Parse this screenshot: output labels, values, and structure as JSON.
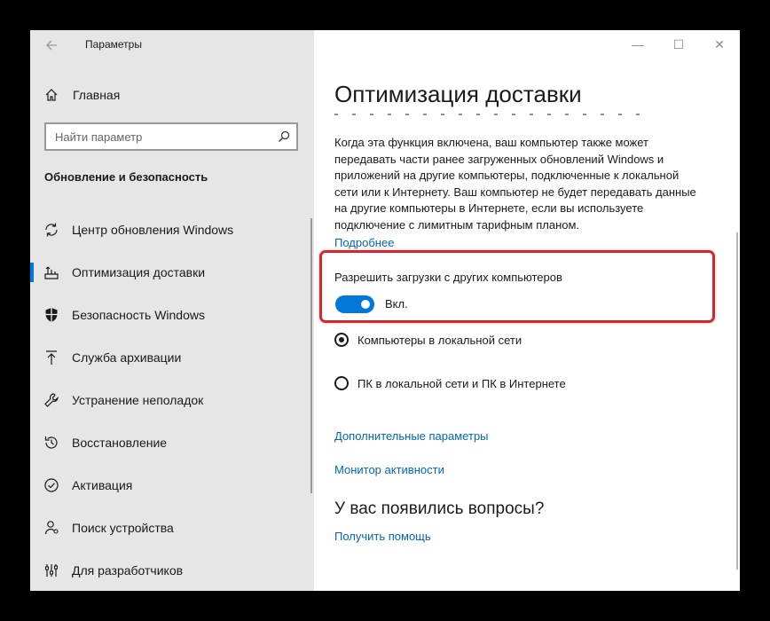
{
  "window": {
    "title": "Параметры",
    "controls": {
      "minimize": "—",
      "maximize": "☐",
      "close": "✕"
    }
  },
  "sidebar": {
    "home_label": "Главная",
    "search_placeholder": "Найти параметр",
    "section_title": "Обновление и безопасность",
    "items": [
      {
        "label": "Центр обновления Windows",
        "icon": "sync-icon",
        "active": false
      },
      {
        "label": "Оптимизация доставки",
        "icon": "delivery-optimization-icon",
        "active": true
      },
      {
        "label": "Безопасность Windows",
        "icon": "shield-icon",
        "active": false
      },
      {
        "label": "Служба архивации",
        "icon": "backup-icon",
        "active": false
      },
      {
        "label": "Устранение неполадок",
        "icon": "wrench-icon",
        "active": false
      },
      {
        "label": "Восстановление",
        "icon": "history-icon",
        "active": false
      },
      {
        "label": "Активация",
        "icon": "check-circle-icon",
        "active": false
      },
      {
        "label": "Поиск устройства",
        "icon": "person-pin-icon",
        "active": false
      },
      {
        "label": "Для разработчиков",
        "icon": "developer-icon",
        "active": false
      }
    ]
  },
  "main": {
    "title": "Оптимизация доставки",
    "description": "Когда эта функция включена, ваш компьютер также может передавать части ранее загруженных обновлений Windows и приложений на другие компьютеры, подключенные к локальной сети или к Интернету. Ваш компьютер не будет передавать данные на другие компьютеры в Интернете, если вы используете подключение с лимитным тарифным планом.",
    "more_link": "Подробнее",
    "allow_label": "Разрешить загрузки с других компьютеров",
    "toggle_state": "Вкл.",
    "toggle_on": true,
    "radio_options": [
      {
        "label": "Компьютеры в локальной сети",
        "checked": true
      },
      {
        "label": "ПК в локальной сети и ПК в Интернете",
        "checked": false
      }
    ],
    "advanced_link": "Дополнительные параметры",
    "monitor_link": "Монитор активности",
    "questions_title": "У вас появились вопросы?",
    "help_link": "Получить помощь"
  },
  "colors": {
    "accent": "#0078d7",
    "link": "#0067b8",
    "highlight": "#d0282c",
    "sidebar_bg": "#e6e6e6"
  }
}
